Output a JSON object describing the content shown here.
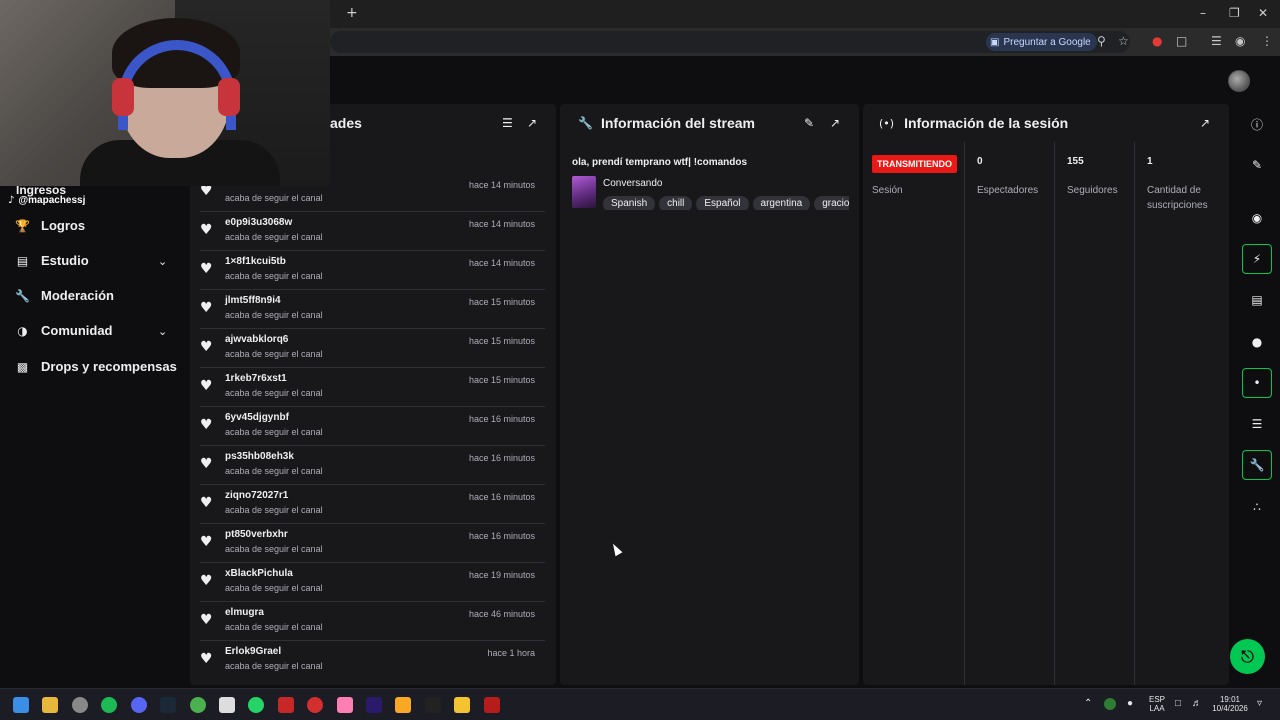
{
  "browser": {
    "ask_google": "Preguntar a Google",
    "new_tab": "+"
  },
  "tiktok_handle": "@mapachessj",
  "nav": {
    "ingresos": "Ingresos",
    "items": [
      {
        "label": "Logros",
        "icon": "trophy-icon"
      },
      {
        "label": "Estudio",
        "icon": "studio-icon"
      },
      {
        "label": "Moderación",
        "icon": "wrench-icon"
      },
      {
        "label": "Comunidad",
        "icon": "community-icon"
      },
      {
        "label": "Drops y recompensas",
        "icon": "drops-icon"
      }
    ]
  },
  "activity": {
    "title": "ades",
    "rows": [
      {
        "user": "",
        "desc": "acaba de seguir el canal",
        "time": "hace 14 minutos"
      },
      {
        "user": "e0p9i3u3068w",
        "desc": "acaba de seguir el canal",
        "time": "hace 14 minutos"
      },
      {
        "user": "1×8f1kcui5tb",
        "desc": "acaba de seguir el canal",
        "time": "hace 14 minutos"
      },
      {
        "user": "jlmt5ff8n9i4",
        "desc": "acaba de seguir el canal",
        "time": "hace 15 minutos"
      },
      {
        "user": "ajwvabklorq6",
        "desc": "acaba de seguir el canal",
        "time": "hace 15 minutos"
      },
      {
        "user": "1rkeb7r6xst1",
        "desc": "acaba de seguir el canal",
        "time": "hace 15 minutos"
      },
      {
        "user": "6yv45djgynbf",
        "desc": "acaba de seguir el canal",
        "time": "hace 16 minutos"
      },
      {
        "user": "ps35hb08eh3k",
        "desc": "acaba de seguir el canal",
        "time": "hace 16 minutos"
      },
      {
        "user": "ziqno72027r1",
        "desc": "acaba de seguir el canal",
        "time": "hace 16 minutos"
      },
      {
        "user": "pt850verbxhr",
        "desc": "acaba de seguir el canal",
        "time": "hace 16 minutos"
      },
      {
        "user": "xBlackPichula",
        "desc": "acaba de seguir el canal",
        "time": "hace 19 minutos"
      },
      {
        "user": "elmugra",
        "desc": "acaba de seguir el canal",
        "time": "hace 46 minutos"
      },
      {
        "user": "Erlok9Grael",
        "desc": "acaba de seguir el canal",
        "time": "hace 1 hora"
      }
    ]
  },
  "stream_info": {
    "title": "Información del stream",
    "stream_title": "ola, prendí temprano wtf| !comandos",
    "category": "Conversando",
    "tags": [
      "Spanish",
      "chill",
      "Español",
      "argentina",
      "gracio"
    ]
  },
  "session": {
    "title": "Información de la sesión",
    "live_badge": "TRANSMITIENDO",
    "session_label": "Sesión",
    "stats": [
      {
        "value": "0",
        "label": "Espectadores"
      },
      {
        "value": "155",
        "label": "Seguidores"
      },
      {
        "value": "1",
        "label": "Cantidad de suscripciones"
      }
    ]
  },
  "taskbar": {
    "lang_top": "ESP",
    "lang_bottom": "LAA",
    "time": "19:01",
    "date": "10/4/2026"
  },
  "colors": {
    "accent": "#00c853",
    "live": "#e91916",
    "panel": "#18181b",
    "background": "#0e0e10"
  }
}
